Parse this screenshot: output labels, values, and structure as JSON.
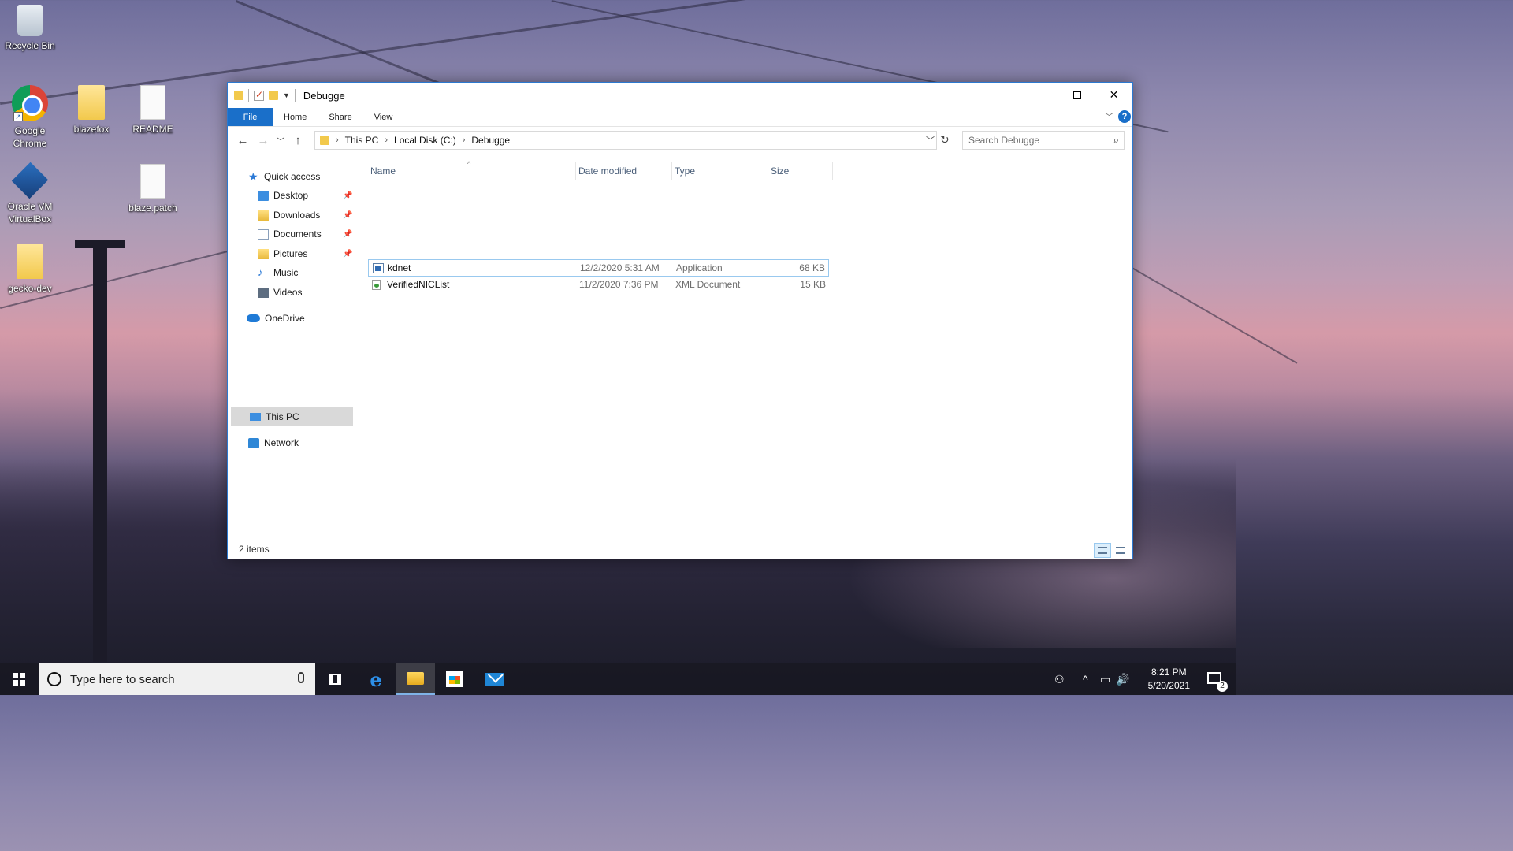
{
  "desktop": {
    "icons": [
      {
        "label": "Recycle Bin",
        "icon": "recycle-bin-icon"
      },
      {
        "label": "Google Chrome",
        "icon": "chrome-icon"
      },
      {
        "label": "blazefox",
        "icon": "folder-icon"
      },
      {
        "label": "README",
        "icon": "document-icon"
      },
      {
        "label": "Oracle VM VirtualBox",
        "icon": "virtualbox-icon"
      },
      {
        "label": "blaze.patch",
        "icon": "document-icon"
      },
      {
        "label": "gecko-dev",
        "icon": "folder-icon"
      }
    ]
  },
  "window": {
    "title": "Debugge",
    "ribbon_tabs": [
      "File",
      "Home",
      "Share",
      "View"
    ],
    "help_label": "?",
    "address": {
      "crumbs": [
        "This PC",
        "Local Disk (C:)",
        "Debugge"
      ]
    },
    "search": {
      "placeholder": "Search Debugge"
    },
    "nav_pane": {
      "quick_access": "Quick access",
      "items": [
        "Desktop",
        "Downloads",
        "Documents",
        "Pictures",
        "Music",
        "Videos"
      ],
      "onedrive": "OneDrive",
      "this_pc": "This PC",
      "network": "Network"
    },
    "columns": {
      "name": "Name",
      "date": "Date modified",
      "type": "Type",
      "size": "Size"
    },
    "files": [
      {
        "name": "kdnet",
        "date": "12/2/2020 5:31 AM",
        "type": "Application",
        "size": "68 KB"
      },
      {
        "name": "VerifiedNICList",
        "date": "11/2/2020 7:36 PM",
        "type": "XML Document",
        "size": "15 KB"
      }
    ],
    "status": {
      "count": "2 items"
    }
  },
  "taskbar": {
    "search_placeholder": "Type here to search",
    "clock": {
      "time": "8:21 PM",
      "date": "5/20/2021"
    },
    "notification_count": "2"
  },
  "colors": {
    "accent": "#1a6fc9",
    "selection_border": "#99c9ef",
    "column_header": "#4c607a"
  }
}
